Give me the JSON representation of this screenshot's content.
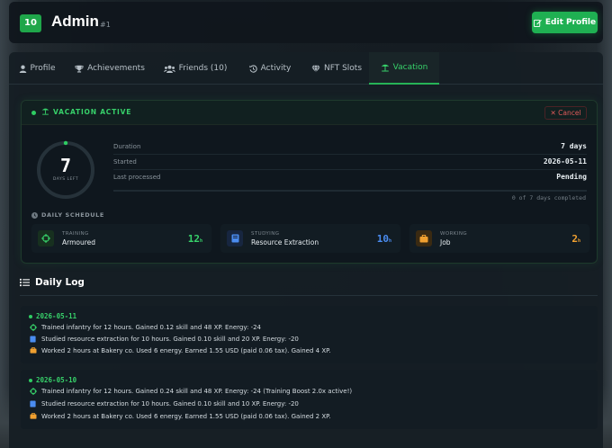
{
  "header": {
    "level": "10",
    "name": "Admin",
    "id": "#1",
    "edit_label": "Edit Profile"
  },
  "tabs": [
    {
      "label": "Profile",
      "icon": "user-icon"
    },
    {
      "label": "Achievements",
      "icon": "trophy-icon"
    },
    {
      "label": "Friends (10)",
      "icon": "users-icon"
    },
    {
      "label": "Activity",
      "icon": "history-icon"
    },
    {
      "label": "NFT Slots",
      "icon": "gem-icon"
    },
    {
      "label": "Vacation",
      "icon": "umbrella-beach-icon",
      "active": true
    }
  ],
  "vacation": {
    "title": "VACATION ACTIVE",
    "cancel_label": "Cancel",
    "days_left": "7",
    "days_left_label": "DAYS LEFT",
    "days_left_progress": 0,
    "stats": [
      {
        "label": "Duration",
        "value": "7 days"
      },
      {
        "label": "Started",
        "value": "2026-05-11"
      },
      {
        "label": "Last processed",
        "value": "Pending"
      }
    ],
    "progress_text": "0 of 7 days completed",
    "progress_fraction": 0,
    "schedule_title": "DAILY SCHEDULE",
    "schedule": [
      {
        "kind": "TRAINING",
        "name": "Armoured",
        "hours": "12",
        "unit": "h",
        "color": "#37d16a",
        "icon": "crosshair-icon"
      },
      {
        "kind": "STUDYING",
        "name": "Resource Extraction",
        "hours": "10",
        "unit": "h",
        "color": "#4a8cf0",
        "icon": "book-icon"
      },
      {
        "kind": "WORKING",
        "name": "Job",
        "hours": "2",
        "unit": "h",
        "color": "#f0a030",
        "icon": "briefcase-icon"
      }
    ]
  },
  "log": {
    "title": "Daily Log",
    "days": [
      {
        "date": "2026-05-11",
        "entries": [
          {
            "icon": "crosshair-icon",
            "color": "#37d16a",
            "text": "Trained infantry for 12 hours. Gained 0.12 skill and 48 XP. Energy: -24"
          },
          {
            "icon": "book-icon",
            "color": "#4a8cf0",
            "text": "Studied resource extraction for 10 hours. Gained 0.10 skill and 20 XP. Energy: -20"
          },
          {
            "icon": "briefcase-icon",
            "color": "#f0a030",
            "text": "Worked 2 hours at Bakery co. Used 6 energy. Earned 1.55 USD (paid 0.06 tax). Gained 4 XP."
          }
        ]
      },
      {
        "date": "2026-05-10",
        "entries": [
          {
            "icon": "crosshair-icon",
            "color": "#37d16a",
            "text": "Trained infantry for 12 hours. Gained 0.24 skill and 48 XP. Energy: -24 (Training Boost 2.0x active!)"
          },
          {
            "icon": "book-icon",
            "color": "#4a8cf0",
            "text": "Studied resource extraction for 10 hours. Gained 0.10 skill and 10 XP. Energy: -20"
          },
          {
            "icon": "briefcase-icon",
            "color": "#f0a030",
            "text": "Worked 2 hours at Bakery co. Used 6 energy. Earned 1.55 USD (paid 0.06 tax). Gained 2 XP."
          }
        ]
      }
    ]
  },
  "colors": {
    "accent": "#1fb052",
    "danger": "#e05a5a",
    "background": "#10161c"
  }
}
